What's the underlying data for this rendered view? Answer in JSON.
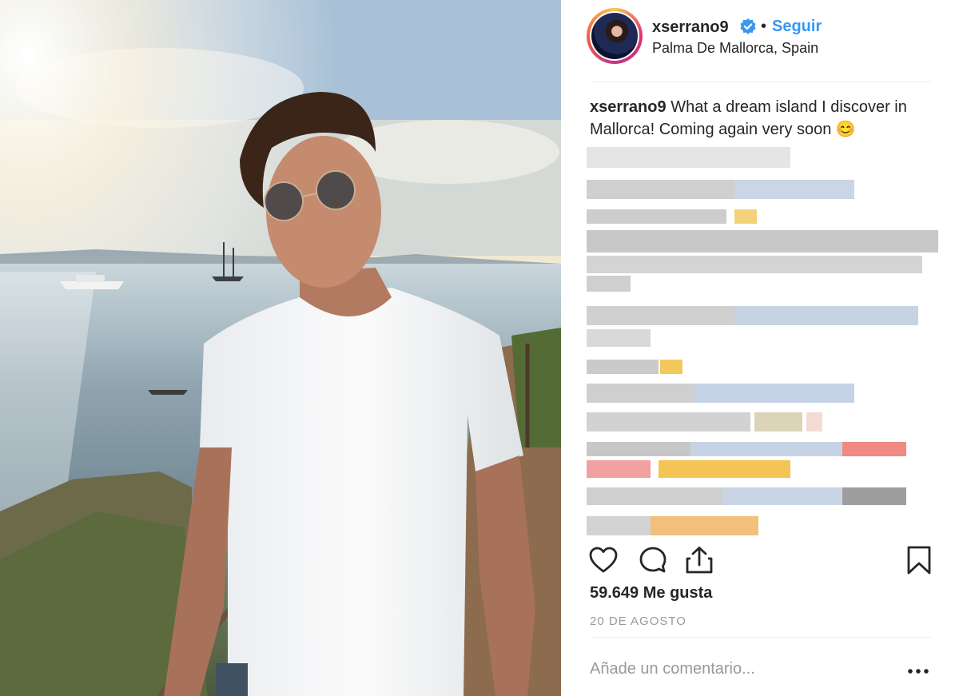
{
  "post": {
    "photo_alt": "Photo"
  },
  "header": {
    "username": "xserrano9",
    "separator": "•",
    "follow_label": "Seguir",
    "location": "Palma De Mallorca, Spain"
  },
  "caption": {
    "username": "xserrano9",
    "text": "What a dream island I discover in Mallorca! Coming again very soon 😊"
  },
  "stats": {
    "likes": "59.649 Me gusta",
    "date": "20 DE AGOSTO"
  },
  "comment_box": {
    "placeholder": "Añade un comentario..."
  },
  "colors": {
    "accent": "#3897f0",
    "muted": "#999999",
    "text": "#262626"
  }
}
